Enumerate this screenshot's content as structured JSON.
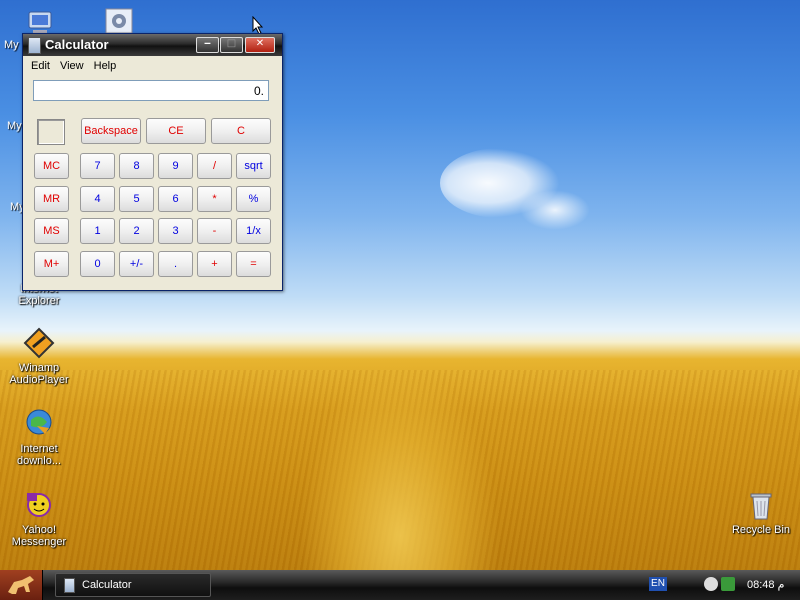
{
  "desktop": {
    "icons": [
      {
        "label": "My",
        "icon": "my-computer-icon"
      },
      {
        "label": "My",
        "icon": "my-documents-icon"
      },
      {
        "label": "My",
        "icon": "my-network-icon"
      },
      {
        "label": "Internet Explorer",
        "icon": "internet-explorer-icon"
      },
      {
        "label": "Winamp AudioPlayer",
        "icon": "winamp-icon"
      },
      {
        "label": "Internet downlo...",
        "icon": "internet-download-manager-icon"
      },
      {
        "label": "Yahoo! Messenger",
        "icon": "yahoo-messenger-icon"
      },
      {
        "label": "Recycle Bin",
        "icon": "recycle-bin-icon"
      }
    ]
  },
  "calculator": {
    "title": "Calculator",
    "menu": [
      "Edit",
      "View",
      "Help"
    ],
    "display": "0.",
    "top_buttons": [
      "Backspace",
      "CE",
      "C"
    ],
    "memory_buttons": [
      "MC",
      "MR",
      "MS",
      "M+"
    ],
    "rows": [
      [
        "7",
        "8",
        "9",
        "/",
        "sqrt"
      ],
      [
        "4",
        "5",
        "6",
        "*",
        "%"
      ],
      [
        "1",
        "2",
        "3",
        "-",
        "1/x"
      ],
      [
        "0",
        "+/-",
        ".",
        "+",
        "="
      ]
    ],
    "colors": {
      "red": "#e00000",
      "blue": "#0000e0"
    }
  },
  "taskbar": {
    "task_button": "Calculator",
    "language": "EN",
    "clock": "08:48 ﻡ"
  }
}
